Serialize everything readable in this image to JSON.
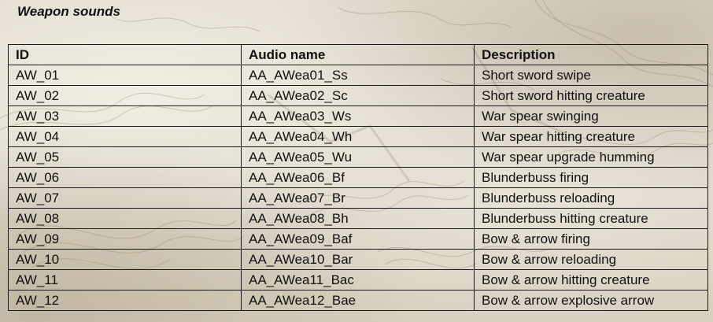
{
  "section_title": "Weapon sounds",
  "table": {
    "headers": [
      "ID",
      "Audio name",
      "Description"
    ],
    "rows": [
      [
        "AW_01",
        "AA_AWea01_Ss",
        "Short sword swipe"
      ],
      [
        "AW_02",
        "AA_AWea02_Sc",
        "Short sword hitting creature"
      ],
      [
        "AW_03",
        "AA_AWea03_Ws",
        "War spear swinging"
      ],
      [
        "AW_04",
        "AA_AWea04_Wh",
        "War spear hitting creature"
      ],
      [
        "AW_05",
        "AA_AWea05_Wu",
        "War spear upgrade humming"
      ],
      [
        "AW_06",
        "AA_AWea06_Bf",
        "Blunderbuss firing"
      ],
      [
        "AW_07",
        "AA_AWea07_Br",
        "Blunderbuss reloading"
      ],
      [
        "AW_08",
        "AA_AWea08_Bh",
        "Blunderbuss hitting creature"
      ],
      [
        "AW_09",
        "AA_AWea09_Baf",
        "Bow & arrow firing"
      ],
      [
        "AW_10",
        "AA_AWea10_Bar",
        "Bow & arrow reloading"
      ],
      [
        "AW_11",
        "AA_AWea11_Bac",
        "Bow & arrow hitting creature"
      ],
      [
        "AW_12",
        "AA_AWea12_Bae",
        "Bow & arrow explosive arrow"
      ]
    ]
  },
  "colors": {
    "text": "#111111",
    "border": "#1a1a1a",
    "parchment": "#ddd6c6"
  }
}
